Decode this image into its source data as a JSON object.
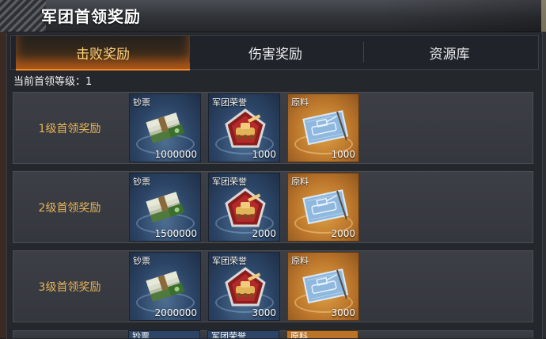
{
  "window": {
    "title": "军团首领奖励"
  },
  "tabs": [
    {
      "label": "击败奖励",
      "active": true
    },
    {
      "label": "伤害奖励",
      "active": false
    },
    {
      "label": "资源库",
      "active": false
    }
  ],
  "level": {
    "text": "当前首领等级：1"
  },
  "item_names": {
    "money": "钞票",
    "honor": "军团荣誉",
    "material": "原料"
  },
  "rows": [
    {
      "label": "1级首领奖励",
      "money": "1000000",
      "honor": "1000",
      "material": "1000"
    },
    {
      "label": "2级首领奖励",
      "money": "1500000",
      "honor": "2000",
      "material": "2000"
    },
    {
      "label": "3级首领奖励",
      "money": "2000000",
      "honor": "3000",
      "material": "3000"
    }
  ],
  "colors": {
    "active_tab": "#ffd37a",
    "tab_glow": "#f08b2a",
    "row_label": "#e7b35a",
    "item_blue": "#2c4566",
    "item_gold": "#b9742a"
  },
  "icons": {
    "money": "cash-stack-icon",
    "honor": "legion-honor-emblem-icon",
    "material": "blueprint-icon"
  }
}
